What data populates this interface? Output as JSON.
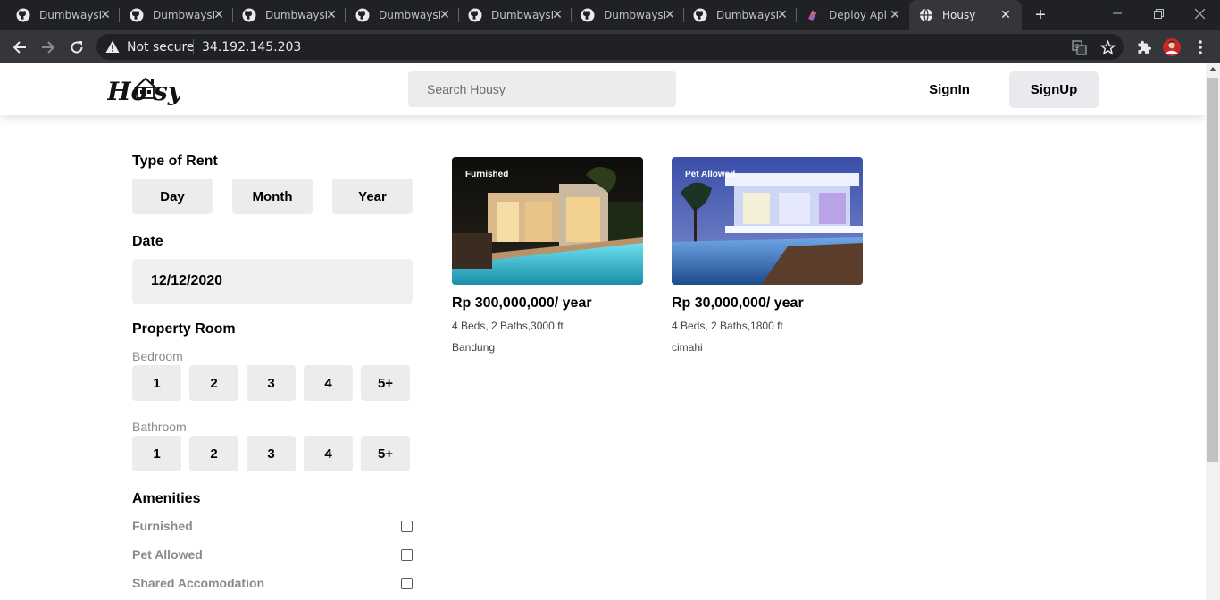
{
  "browser": {
    "tabs": [
      {
        "label": "DumbwaysI",
        "icon": "github-icon"
      },
      {
        "label": "DumbwaysI",
        "icon": "github-icon"
      },
      {
        "label": "DumbwaysI",
        "icon": "github-icon"
      },
      {
        "label": "DumbwaysI",
        "icon": "github-icon"
      },
      {
        "label": "DumbwaysI",
        "icon": "github-icon"
      },
      {
        "label": "DumbwaysI",
        "icon": "github-icon"
      },
      {
        "label": "DumbwaysI",
        "icon": "github-icon"
      },
      {
        "label": "Deploy Apl",
        "icon": "deploy-icon"
      },
      {
        "label": "Housy",
        "icon": "globe-icon",
        "active": true
      }
    ],
    "security_label": "Not secure",
    "url": "34.192.145.203"
  },
  "header": {
    "logo_text": "Housy",
    "search_placeholder": "Search Housy",
    "signin_label": "SignIn",
    "signup_label": "SignUp"
  },
  "filters": {
    "type_of_rent": {
      "title": "Type of Rent",
      "options": [
        "Day",
        "Month",
        "Year"
      ]
    },
    "date": {
      "title": "Date",
      "value": "12/12/2020"
    },
    "property_room": {
      "title": "Property Room",
      "bedroom": {
        "label": "Bedroom",
        "options": [
          "1",
          "2",
          "3",
          "4",
          "5+"
        ]
      },
      "bathroom": {
        "label": "Bathroom",
        "options": [
          "1",
          "2",
          "3",
          "4",
          "5+"
        ]
      }
    },
    "amenities": {
      "title": "Amenities",
      "items": [
        {
          "label": "Furnished",
          "checked": false
        },
        {
          "label": "Pet Allowed",
          "checked": false
        },
        {
          "label": "Shared Accomodation",
          "checked": false
        }
      ]
    }
  },
  "listings": [
    {
      "badge": "Furnished",
      "price": "Rp 300,000,000/ year",
      "specs": "4 Beds, 2 Baths,3000 ft",
      "city": "Bandung"
    },
    {
      "badge": "Pet Allowed",
      "price": "Rp 30,000,000/ year",
      "specs": "4 Beds, 2 Baths,1800 ft",
      "city": "cimahi"
    }
  ],
  "colors": {
    "tabbar": "#202124",
    "toolbar": "#35363a",
    "button_bg": "#ececec",
    "signup_bg": "#e8eaed"
  }
}
